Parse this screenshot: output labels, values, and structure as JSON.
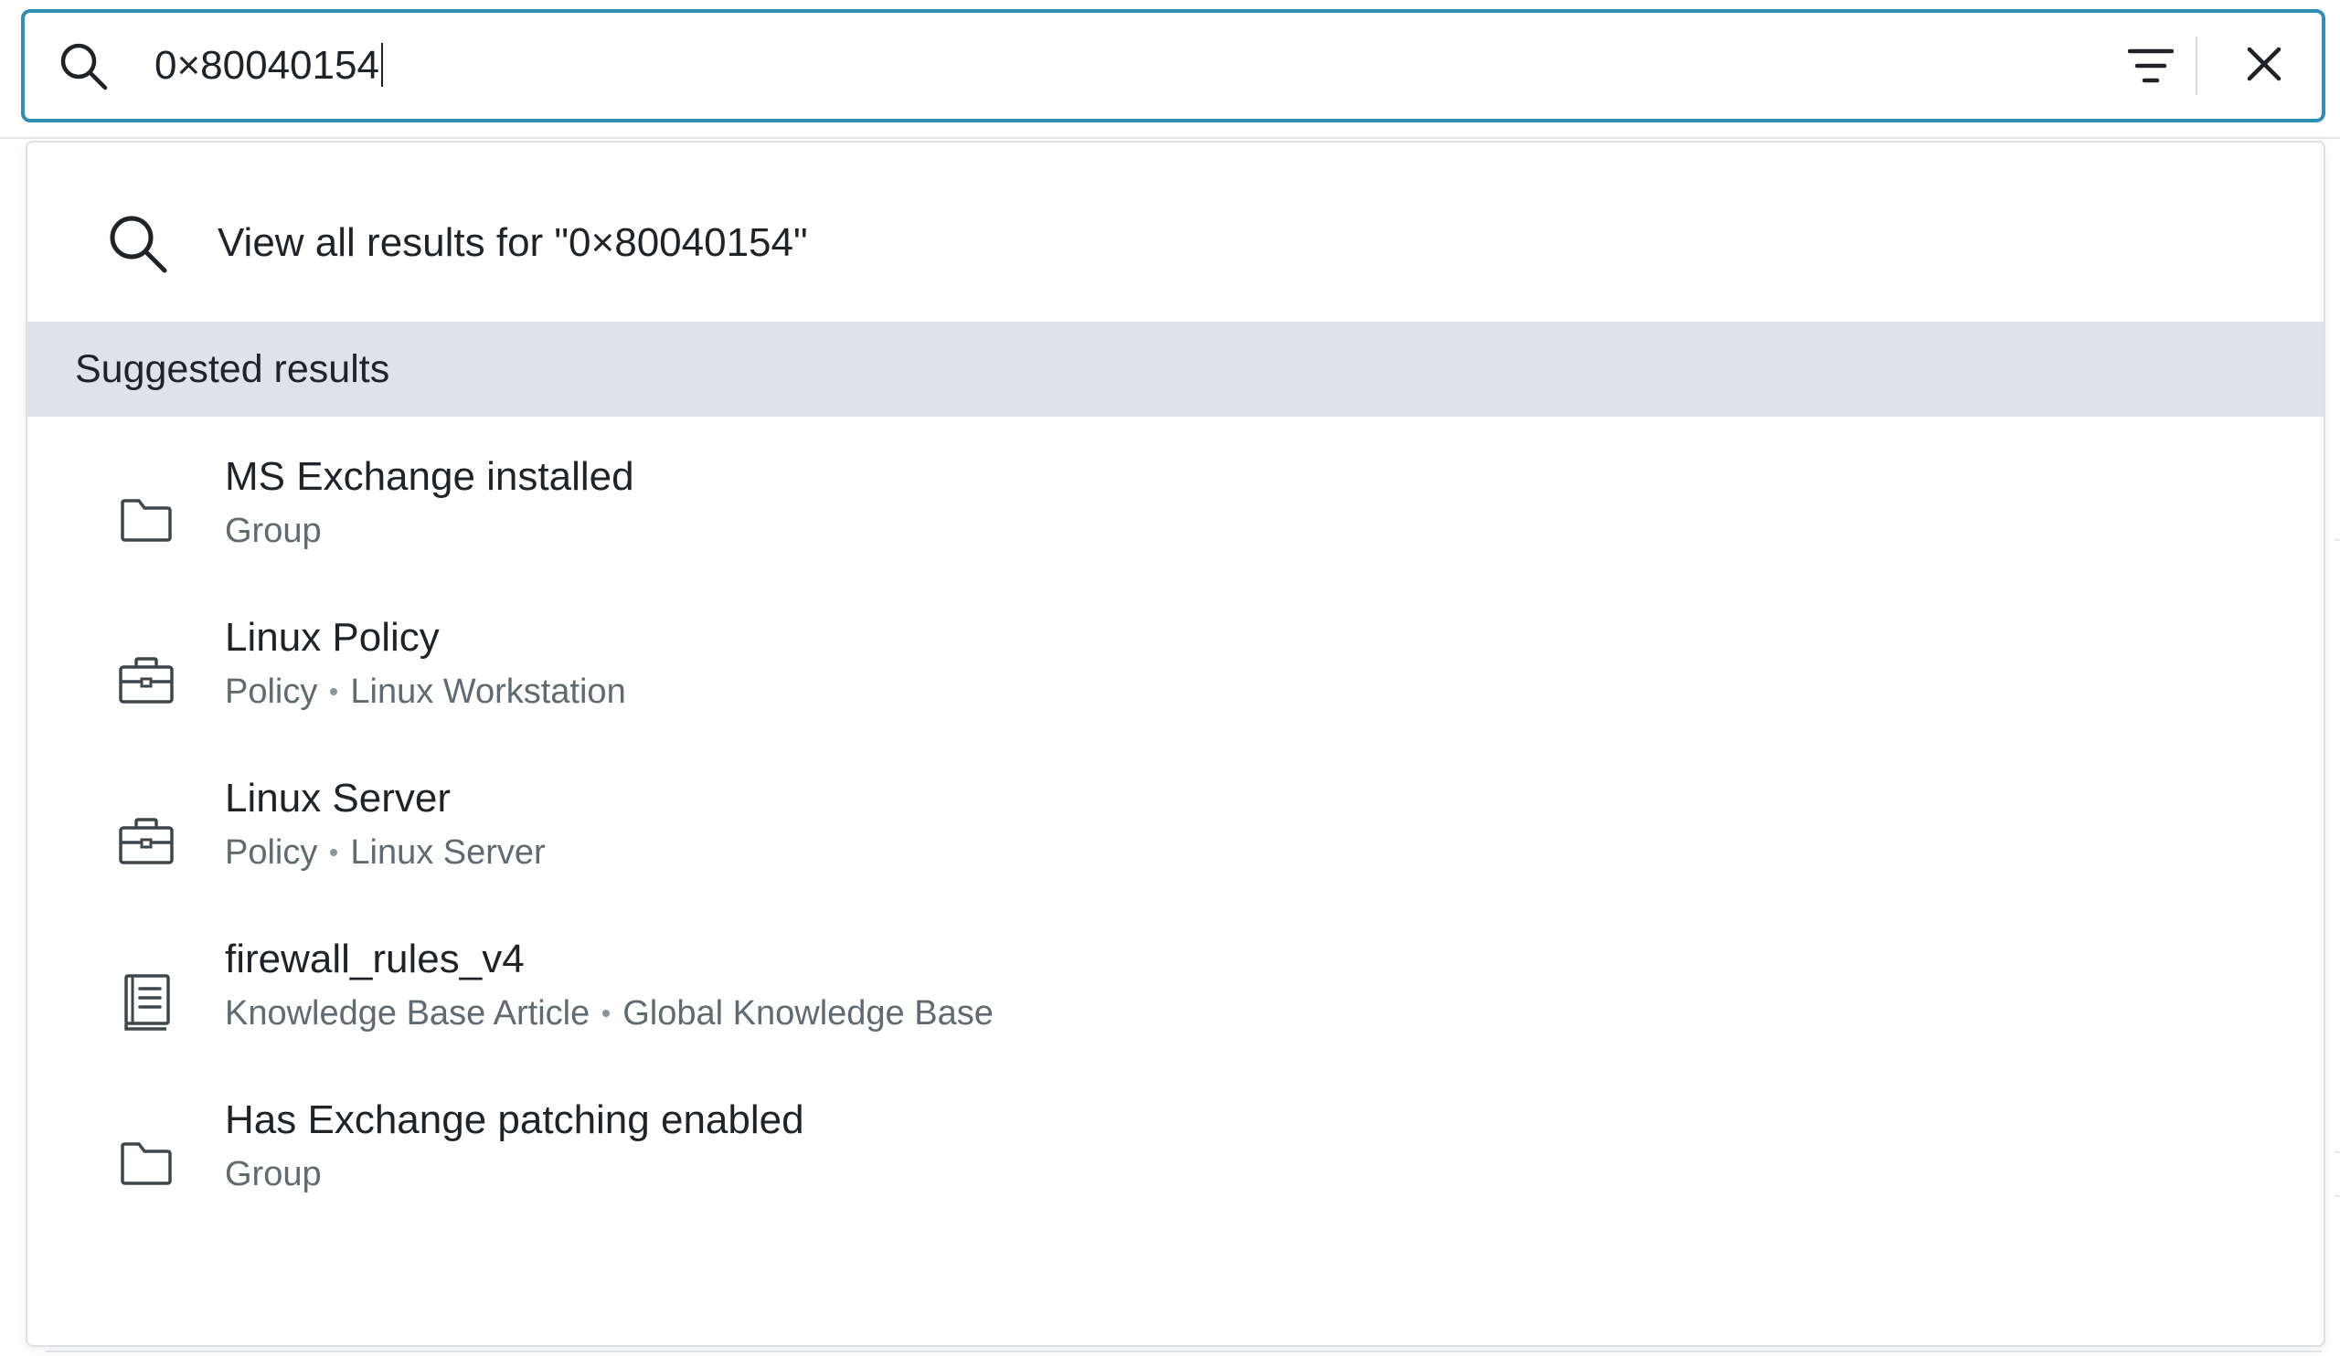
{
  "search": {
    "value": "0×80040154",
    "icon": "search-icon",
    "filter_icon": "filter-icon",
    "clear_icon": "close-icon"
  },
  "dropdown": {
    "view_all_label": "View all results for \"0×80040154\"",
    "section_title": "Suggested results",
    "results": [
      {
        "icon": "folder-icon",
        "title": "MS Exchange installed",
        "type": "Group",
        "context": ""
      },
      {
        "icon": "briefcase-icon",
        "title": "Linux Policy",
        "type": "Policy",
        "context": "Linux Workstation"
      },
      {
        "icon": "briefcase-icon",
        "title": "Linux Server",
        "type": "Policy",
        "context": "Linux Server"
      },
      {
        "icon": "book-icon",
        "title": "firewall_rules_v4",
        "type": "Knowledge Base Article",
        "context": "Global Knowledge Base"
      },
      {
        "icon": "folder-icon",
        "title": "Has Exchange patching enabled",
        "type": "Group",
        "context": ""
      }
    ]
  },
  "colors": {
    "focus_border": "#2e8fb0",
    "section_bg": "#dee3e7",
    "secondary_text": "#5f6a73"
  }
}
